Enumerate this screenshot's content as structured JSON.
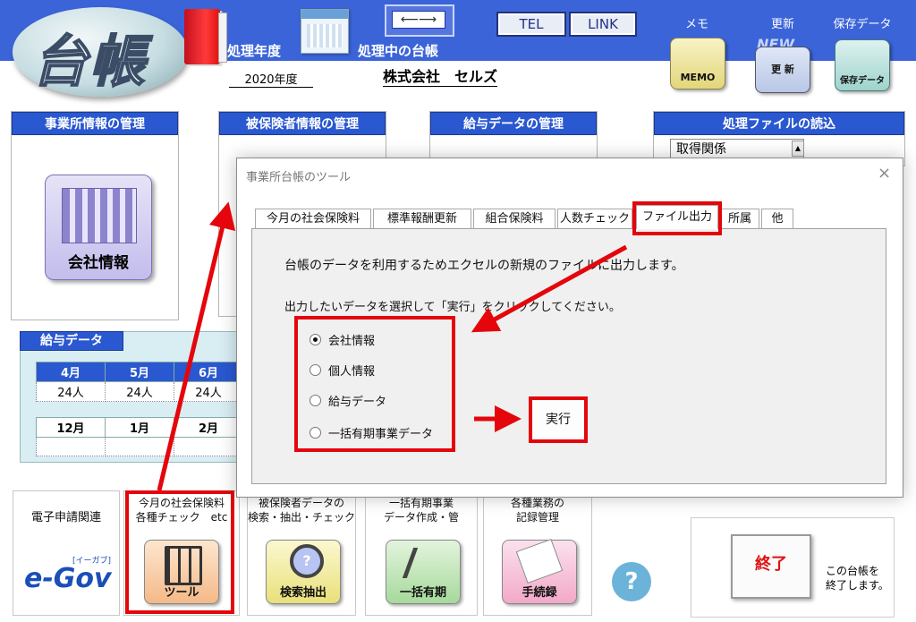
{
  "header": {
    "logo_text": "台帳",
    "year_label": "処理年度",
    "year_value": "2020年度",
    "current_ledger_label": "処理中の台帳",
    "company_name": "株式会社　セルズ",
    "tel_button": "TEL",
    "link_button": "LINK",
    "arrows_icon_text": "⟵⟶",
    "memo_label": "メモ",
    "memo_icon_text": "MEMO",
    "update_label": "更新",
    "update_badge": "NEW",
    "update_icon_text": "更 新",
    "saved_data_label": "保存データ",
    "saved_data_icon_text": "保存データ"
  },
  "panels": {
    "office": {
      "title": "事業所情報の管理",
      "icon_label": "会社情報"
    },
    "insured": {
      "title": "被保険者情報の管理"
    },
    "salary_mgmt": {
      "title": "給与データの管理"
    },
    "file_read": {
      "title": "処理ファイルの読込",
      "select_value": "取得関係"
    }
  },
  "salary": {
    "title": "給与データ",
    "row1": {
      "months": [
        "4月",
        "5月",
        "6月"
      ],
      "counts": [
        "24人",
        "24人",
        "24人"
      ]
    },
    "row2": {
      "months": [
        "12月",
        "1月",
        "2月"
      ],
      "counts": [
        "",
        "",
        ""
      ]
    }
  },
  "dialog": {
    "title": "事業所台帳のツール",
    "close_glyph": "×",
    "tabs": [
      "今月の社会保険料",
      "標準報酬更新",
      "組合保険料",
      "人数チェック",
      "ファイル出力",
      "所属",
      "他"
    ],
    "active_tab": "ファイル出力",
    "description": "台帳のデータを利用するためエクセルの新規のファイルに出力します。",
    "instruction": "出力したいデータを選択して「実行」をクリックしてください。",
    "options": [
      "会社情報",
      "個人情報",
      "給与データ",
      "一括有期事業データ"
    ],
    "selected_option": "会社情報",
    "execute_button": "実行"
  },
  "toolbar": {
    "egov": {
      "label": "電子申請関連",
      "logo_text": "e-Gov",
      "logo_sub": "[イーガブ]"
    },
    "tools": {
      "label1": "今月の社会保険料",
      "label2": "各種チェック　etc",
      "icon_label": "ツール"
    },
    "search": {
      "label1": "被保険者データの",
      "label2": "検索・抽出・チェック",
      "icon_label": "検索抽出"
    },
    "lumpsum": {
      "label1": "一括有期事業",
      "label2": "データ作成・管",
      "icon_label": "一括有期"
    },
    "procedures": {
      "label1": "各種業務の",
      "label2": "記録管理",
      "icon_label": "手続録"
    },
    "help_glyph": "?",
    "end_button": "終了",
    "end_caption1": "この台帳を",
    "end_caption2": "終了します。"
  },
  "colors": {
    "header_blue": "#3b64d9",
    "highlight_red": "#e4060c",
    "panel_title_blue": "#2a58d0"
  }
}
